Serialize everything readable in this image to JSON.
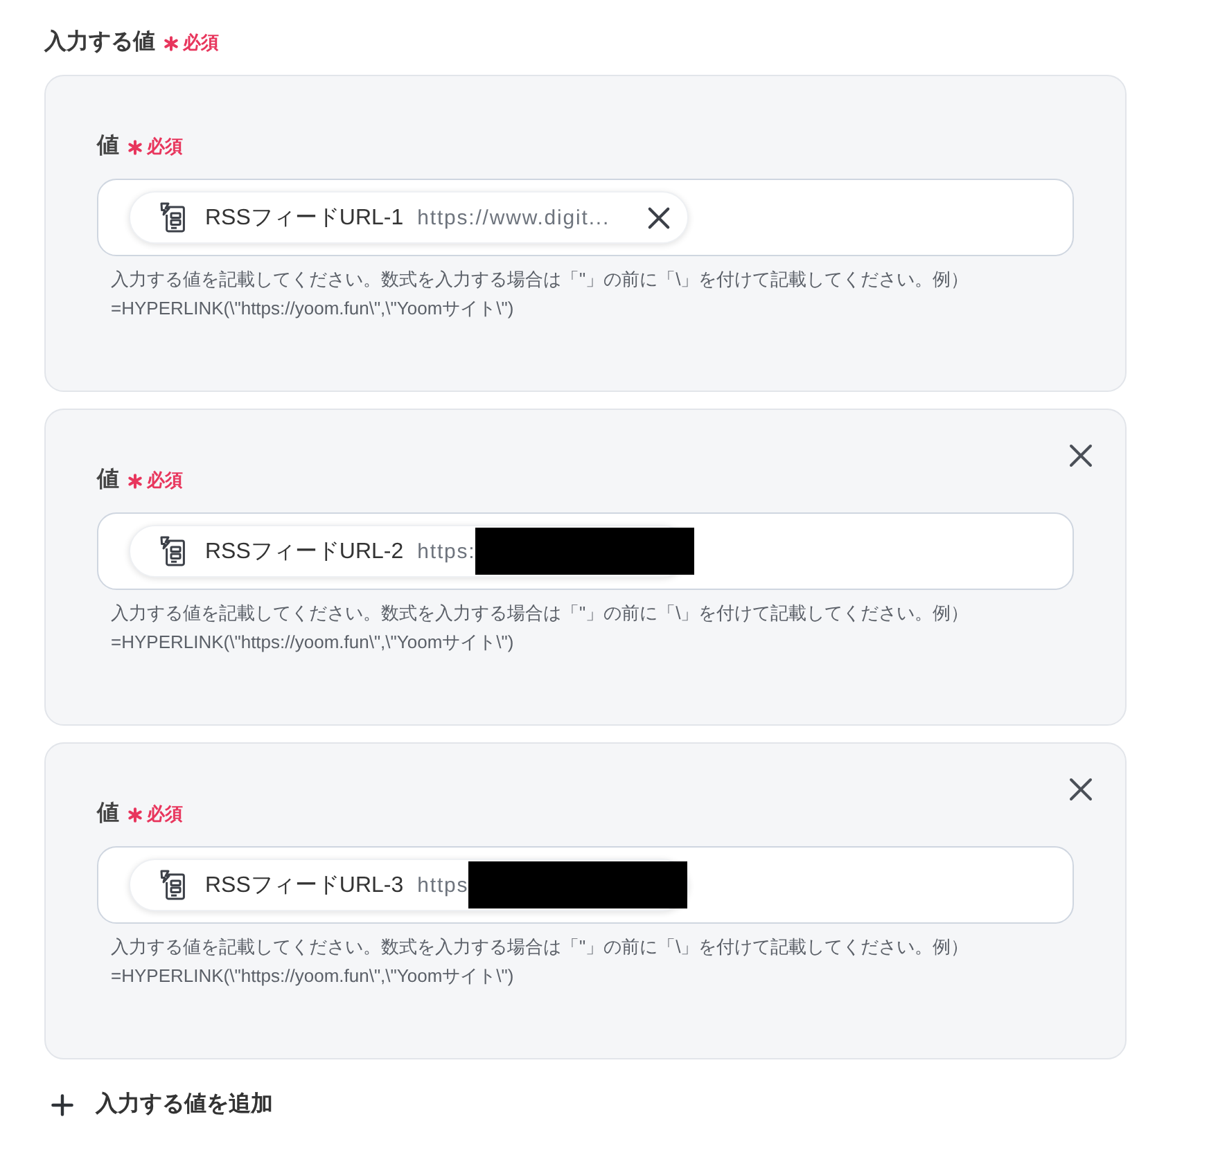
{
  "field": {
    "label": "入力する値",
    "required": true,
    "required_text": "必須"
  },
  "values": [
    {
      "label": "値",
      "required": true,
      "required_text": "必須",
      "removable": false,
      "chip": {
        "name": "RSSフィードURL-1",
        "value": "https://www.digit...",
        "clearable": true,
        "redacted": false
      },
      "help_lines": [
        "入力する値を記載してください。数式を入力する場合は「\"」の前に「\\」を付けて記載してください。例）",
        "=HYPERLINK(\\\"https://yoom.fun\\\",\\\"Yoomサイト\\\")"
      ]
    },
    {
      "label": "値",
      "required": true,
      "required_text": "必須",
      "removable": true,
      "chip": {
        "name": "RSSフィードURL-2",
        "value": "https:",
        "clearable": false,
        "redacted": true
      },
      "help_lines": [
        "入力する値を記載してください。数式を入力する場合は「\"」の前に「\\」を付けて記載してください。例）",
        "=HYPERLINK(\\\"https://yoom.fun\\\",\\\"Yoomサイト\\\")"
      ]
    },
    {
      "label": "値",
      "required": true,
      "required_text": "必須",
      "removable": true,
      "chip": {
        "name": "RSSフィードURL-3",
        "value": "https",
        "clearable": false,
        "redacted": true
      },
      "help_lines": [
        "入力する値を記載してください。数式を入力する場合は「\"」の前に「\\」を付けて記載してください。例）",
        "=HYPERLINK(\\\"https://yoom.fun\\\",\\\"Yoomサイト\\\")"
      ]
    }
  ],
  "add_button": {
    "label": "入力する値を追加"
  }
}
